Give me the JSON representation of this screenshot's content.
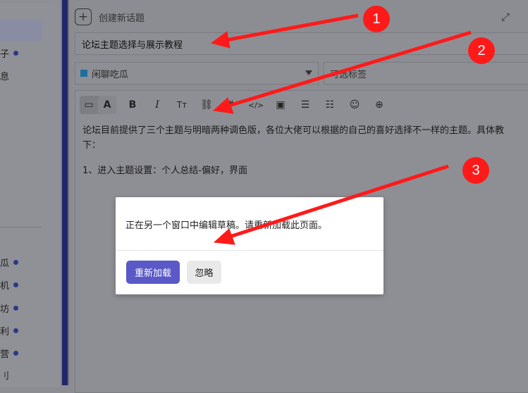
{
  "sidebar": {
    "items_top": [
      {
        "label": "子",
        "dot": true
      },
      {
        "label": "息",
        "dot": false
      }
    ],
    "items_bottom": [
      {
        "label": "瓜",
        "dot": true
      },
      {
        "label": "机",
        "dot": true
      },
      {
        "label": "坊",
        "dot": true
      },
      {
        "label": "利",
        "dot": true
      },
      {
        "label": "营",
        "dot": true
      },
      {
        "label": "刂",
        "dot": false
      }
    ]
  },
  "composer": {
    "create_label": "创建新话题",
    "expand_icon": "expand-icon",
    "title_value": "论坛主题选择与展示教程",
    "category_value": "闲聊吃瓜",
    "category_color": "#1d6fa0",
    "tag_placeholder": "可选标签",
    "toolbar_icons": [
      "markdown-icon",
      "rich-text-icon",
      "bold-icon",
      "italic-icon",
      "heading-icon",
      "link-icon",
      "quote-icon",
      "code-icon",
      "image-icon",
      "bullet-list-icon",
      "numbered-list-icon",
      "emoji-icon",
      "more-icon"
    ],
    "body_line1": "论坛目前提供了三个主题与明暗两种调色版，各位大佬可以根据的自己的喜好选择不一样的主题。具体教\n下：",
    "body_line2": "1、进入主题设置：个人总结-偏好，界面"
  },
  "dialog": {
    "message": "正在另一个窗口中编辑草稿。请重新加载此页面。",
    "reload_label": "重新加载",
    "ignore_label": "忽略",
    "primary_color": "#5b58c8"
  },
  "annotations": [
    {
      "label": "1"
    },
    {
      "label": "2"
    },
    {
      "label": "3"
    }
  ]
}
